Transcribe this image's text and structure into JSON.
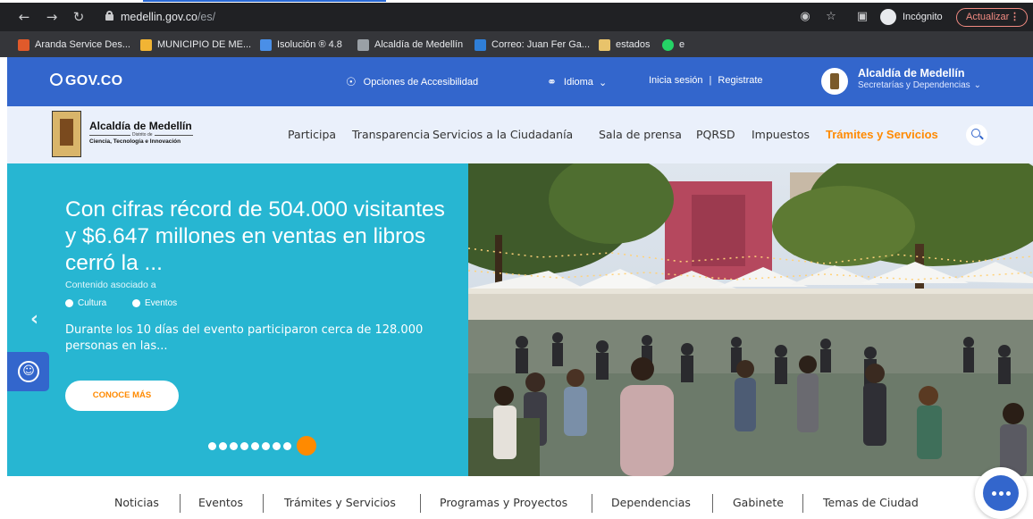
{
  "browser": {
    "url_host": "medellin.gov.co",
    "url_path": "/es/",
    "incognito_label": "Incógnito",
    "update_label": "Actualizar",
    "back_icon": "arrow-left-icon",
    "forward_icon": "arrow-right-icon",
    "reload_icon": "reload-icon"
  },
  "bookmarks": [
    {
      "label": "Aranda Service Des...",
      "color": "#e05a2b"
    },
    {
      "label": "MUNICIPIO DE ME...",
      "color": "#f1b434"
    },
    {
      "label": "Isolución ® 4.8",
      "color": "#4a8fe7"
    },
    {
      "label": "Alcaldía de Medellín",
      "color": "#9aa0a6"
    },
    {
      "label": "Correo: Juan Fer Ga...",
      "color": "#2f7fd8"
    },
    {
      "label": "estados",
      "color": "#e8c36b"
    },
    {
      "label": "e",
      "color": "#25d366"
    }
  ],
  "govbar": {
    "logo": "GOV.CO",
    "accessibility": "Opciones de Accesibilidad",
    "language": "Idioma",
    "login": "Inicia sesión",
    "separator": "|",
    "register": "Registrate",
    "org_title": "Alcaldía de Medellín",
    "org_sub": "Secretarías y Dependencias"
  },
  "site": {
    "name": "Alcaldía de Medellín",
    "district": "Distrito de",
    "sub": "Ciencia, Tecnología e Innovación",
    "menu": [
      "Participa",
      "Transparencia",
      "Servicios a la Ciudadanía",
      "Sala de prensa",
      "PQRSD",
      "Impuestos",
      "Trámites y Servicios"
    ],
    "active_menu": "Trámites y Servicios"
  },
  "hero": {
    "title": "Con cifras récord de 504.000 visitantes y $6.647 millones en ventas en libros cerró la ...",
    "associated": "Contenido asociado a",
    "tags": [
      "Cultura",
      "Eventos"
    ],
    "description": "Durante los 10 días del evento participaron cerca de 128.000 personas en las...",
    "cta": "CONOCE MÁS",
    "slides_total": 9,
    "active_slide": 9,
    "accent": "#ff8a00",
    "panel_color": "#27b6d2"
  },
  "bottom_nav": [
    "Noticias",
    "Eventos",
    "Trámites y Servicios",
    "Programas y Proyectos",
    "Dependencias",
    "Gabinete",
    "Temas de Ciudad"
  ],
  "colors": {
    "gov_blue": "#3366cc",
    "header_bg": "#eaf0fb",
    "accent": "#ff8a00"
  }
}
